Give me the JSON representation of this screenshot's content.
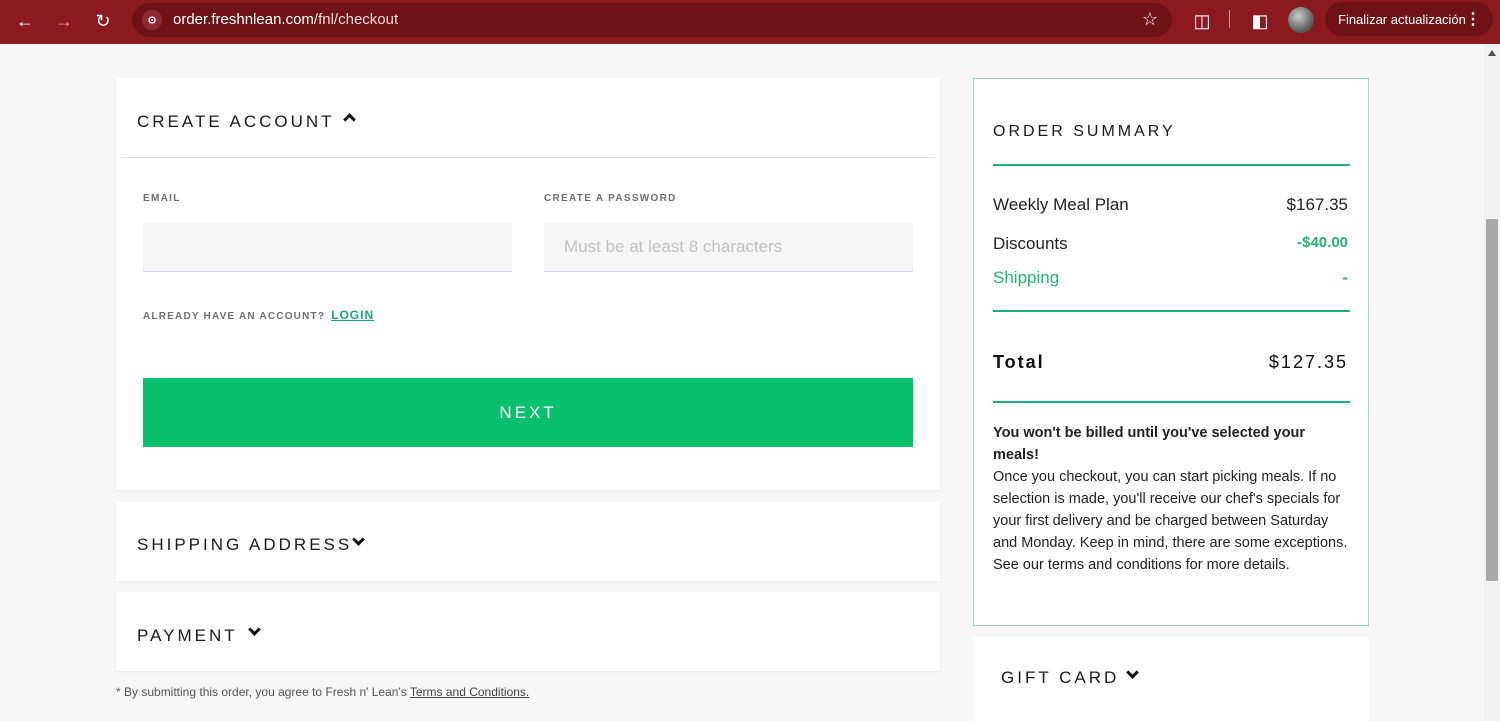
{
  "browser": {
    "url_host": "order.freshnlean.com",
    "url_path": "/fnl/checkout",
    "update_button": "Finalizar actualización"
  },
  "create_account": {
    "title": "CREATE ACCOUNT",
    "email_label": "EMAIL",
    "email_value": "",
    "password_label": "CREATE A PASSWORD",
    "password_placeholder": "Must be at least 8 characters",
    "already_have_account": "ALREADY HAVE AN ACCOUNT?",
    "login_link": "LOGIN",
    "next_button": "NEXT"
  },
  "shipping": {
    "title": "SHIPPING ADDRESS"
  },
  "payment": {
    "title": "PAYMENT"
  },
  "disclaimer": {
    "text": "* By submitting this order, you agree to Fresh n' Lean's ",
    "link": "Terms and Conditions."
  },
  "order_summary": {
    "title": "ORDER SUMMARY",
    "rows": [
      {
        "label": "Weekly Meal Plan",
        "value": "$167.35"
      },
      {
        "label": "Discounts",
        "value": "-$40.00"
      },
      {
        "label": "Shipping",
        "value": "-"
      }
    ],
    "total_label": "Total",
    "total_value": "$127.35",
    "bill_note_heading": "You won't be billed until you've selected your meals!",
    "bill_note_body": "Once you checkout, you can start picking meals. If no selection is made, you'll receive our chef's specials for your first delivery and be charged between Saturday and Monday. Keep in mind, there are some exceptions. See our terms and conditions for more details."
  },
  "gift_card": {
    "title": "GIFT CARD"
  },
  "colors": {
    "brand_green": "#07c06e",
    "chrome_red": "#8b1a1e",
    "summary_accent": "#22b573"
  }
}
